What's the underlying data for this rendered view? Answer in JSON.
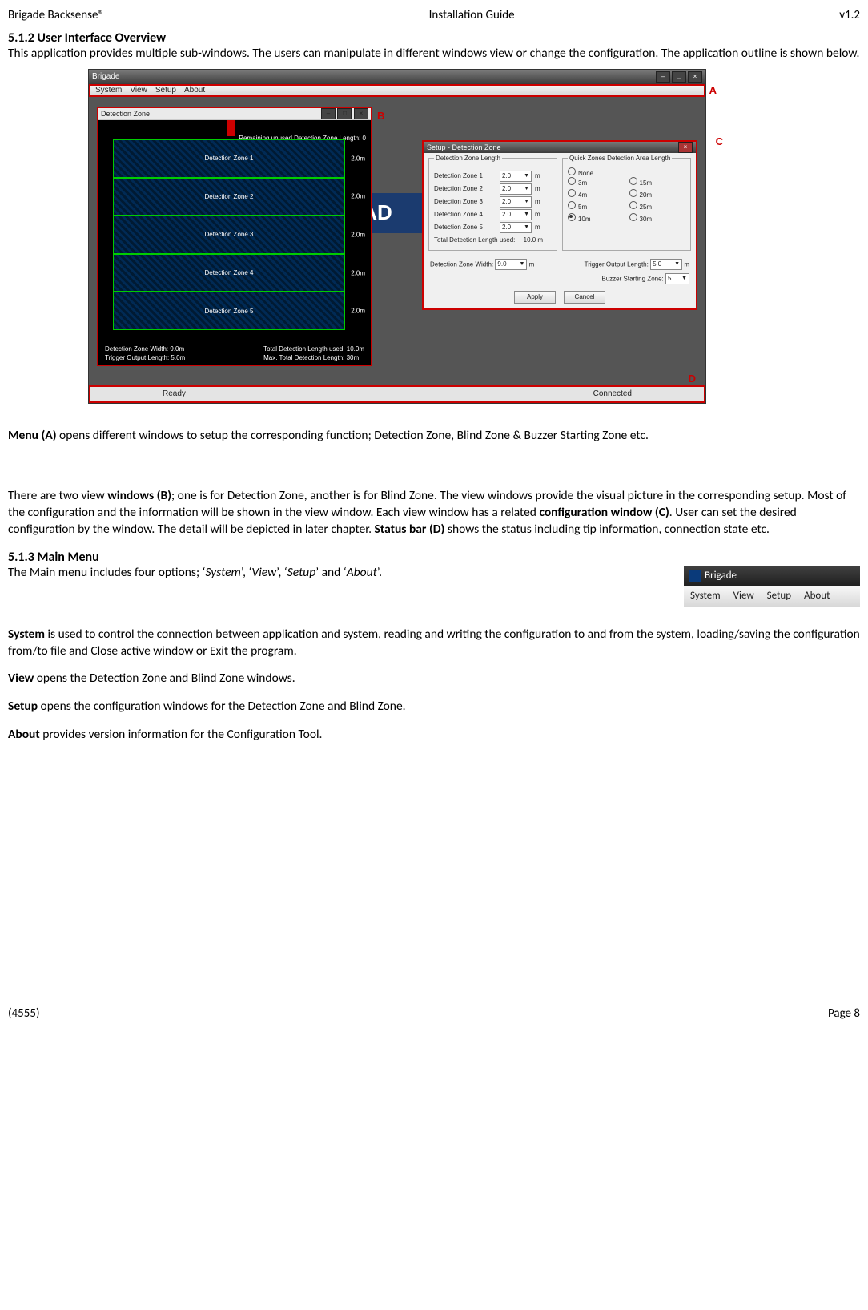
{
  "header": {
    "left": "Brigade Backsense®",
    "center": "Installation Guide",
    "right": "v1.2"
  },
  "section512_title": "5.1.2 User Interface Overview",
  "section512_body": "This application provides multiple sub-windows. The users can manipulate in different windows view or change the configuration. The application outline is shown below.",
  "annotations": {
    "A": "A",
    "B": "B",
    "C": "C",
    "D": "D"
  },
  "app": {
    "title": "Brigade",
    "menubar": [
      "System",
      "View",
      "Setup",
      "About"
    ],
    "bg_logo": "AD",
    "view_window": {
      "title": "Detection Zone",
      "remaining_text": "Remaining unused Detection Zone Length: 0",
      "zones": [
        {
          "label": "Detection Zone 1",
          "val": "2.0m"
        },
        {
          "label": "Detection Zone 2",
          "val": "2.0m"
        },
        {
          "label": "Detection Zone 3",
          "val": "2.0m"
        },
        {
          "label": "Detection Zone 4",
          "val": "2.0m"
        },
        {
          "label": "Detection Zone 5",
          "val": "2.0m"
        }
      ],
      "footer": {
        "l1": "Detection Zone Width: 9.0m",
        "l2": "Trigger Output Length: 5.0m",
        "r1": "Total Detection Length used: 10.0m",
        "r2": "Max. Total Detection Length: 30m"
      }
    },
    "config_window": {
      "title": "Setup - Detection Zone",
      "group1_legend": "Detection Zone Length",
      "zones": [
        {
          "label": "Detection Zone 1",
          "val": "2.0",
          "unit": "m"
        },
        {
          "label": "Detection Zone 2",
          "val": "2.0",
          "unit": "m"
        },
        {
          "label": "Detection Zone 3",
          "val": "2.0",
          "unit": "m"
        },
        {
          "label": "Detection Zone 4",
          "val": "2.0",
          "unit": "m"
        },
        {
          "label": "Detection Zone 5",
          "val": "2.0",
          "unit": "m"
        }
      ],
      "total_label": "Total Detection Length used:",
      "total_val": "10.0 m",
      "group2_legend": "Quick Zones Detection Area Length",
      "quick": {
        "none": "None",
        "opts": [
          {
            "label": "3m"
          },
          {
            "label": "15m"
          },
          {
            "label": "4m"
          },
          {
            "label": "20m"
          },
          {
            "label": "5m"
          },
          {
            "label": "25m"
          },
          {
            "label": "10m",
            "selected": true
          },
          {
            "label": "30m"
          }
        ]
      },
      "width_label": "Detection Zone Width:",
      "width_val": "9.0",
      "width_unit": "m",
      "trigger_label": "Trigger Output Length:",
      "trigger_val": "5.0",
      "trigger_unit": "m",
      "buzzer_label": "Buzzer Starting Zone:",
      "buzzer_val": "5",
      "apply": "Apply",
      "cancel": "Cancel"
    },
    "statusbar": {
      "left": "Ready",
      "right": "Connected"
    }
  },
  "para_menuA": {
    "lead": "Menu (A) ",
    "text": "opens different windows to setup the corresponding function; Detection Zone, Blind Zone & Buzzer Starting Zone etc."
  },
  "para_B": {
    "p1": "There are two view ",
    "b1": "windows (B)",
    "p2": "; one is for Detection Zone, another is for Blind Zone. The view windows provide the visual picture in the corresponding setup. Most of the configuration and the information will be shown in the view window. Each view window has a related ",
    "b2": "configuration window (C)",
    "p3": ". User can set the desired configuration by the window. The detail will be depicted in later chapter. ",
    "b3": "Status bar (D)",
    "p4": " shows the status including tip information, connection state etc."
  },
  "section513_title": "5.1.3 Main Menu",
  "section513_intro": {
    "p1": "The Main menu includes four options; ‘",
    "i1": "System",
    "p2": "’, ‘",
    "i2": "View",
    "p3": "’, ‘",
    "i3": "Setup",
    "p4": "’ and ‘",
    "i4": "About",
    "p5": "’."
  },
  "menu_snippet": {
    "title": "Brigade",
    "items": [
      "System",
      "View",
      "Setup",
      "About"
    ]
  },
  "para_system": {
    "b": "System",
    "t": " is used to control the connection between application and system, reading and writing the configuration to and from the system, loading/saving the configuration from/to file and Close active window or Exit the program."
  },
  "para_view": {
    "b": "View",
    "t": " opens the Detection Zone and Blind Zone windows."
  },
  "para_setup": {
    "b": "Setup",
    "t": " opens the configuration windows for the Detection Zone and Blind Zone."
  },
  "para_about": {
    "b": "About",
    "t": " provides version information for the Configuration Tool."
  },
  "footer": {
    "left": "(4555)",
    "right": "Page 8"
  }
}
